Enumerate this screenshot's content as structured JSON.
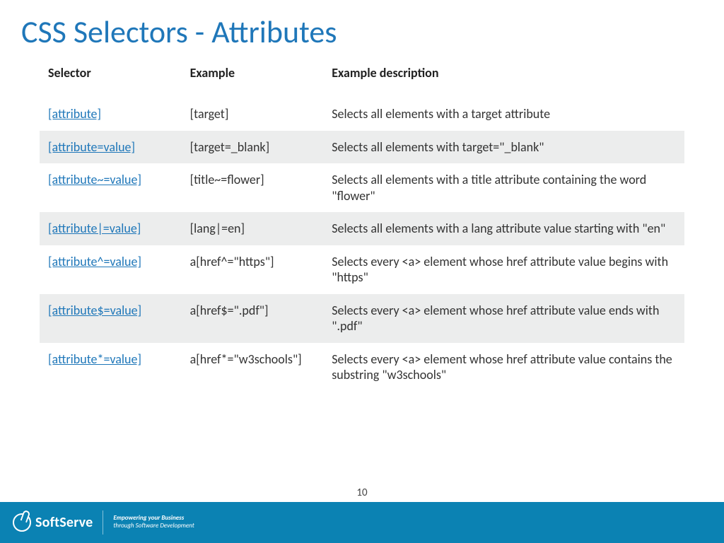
{
  "title": "CSS Selectors - Attributes",
  "headers": {
    "selector": "Selector",
    "example": "Example",
    "description": "Example description"
  },
  "rows": [
    {
      "selector": "[attribute]",
      "example": "[target]",
      "description": "Selects all elements with a target attribute"
    },
    {
      "selector": "[attribute=value]",
      "example": "[target=_blank]",
      "description": "Selects all elements with target=\"_blank\""
    },
    {
      "selector": "[attribute~=value]",
      "example": "[title~=flower]",
      "description": "Selects all elements with a title attribute containing the word \"flower\""
    },
    {
      "selector": "[attribute|=value]",
      "example": "[lang|=en]",
      "description": "Selects all elements with a lang attribute value starting with \"en\""
    },
    {
      "selector": "[attribute^=value]",
      "example": "a[href^=\"https\"]",
      "description": "Selects every <a> element whose href attribute value begins with \"https\""
    },
    {
      "selector": "[attribute$=value]",
      "example": "a[href$=\".pdf\"]",
      "description": "Selects every <a> element whose href attribute value ends with \".pdf\""
    },
    {
      "selector": "[attribute*=value]",
      "example": "a[href*=\"w3schools\"]",
      "description": "Selects every <a> element whose href attribute value contains the substring \"w3schools\""
    }
  ],
  "footer": {
    "brand": "SoftServe",
    "tagline1": "Empowering your Business",
    "tagline2": "through Software Development"
  },
  "page_number": "10"
}
